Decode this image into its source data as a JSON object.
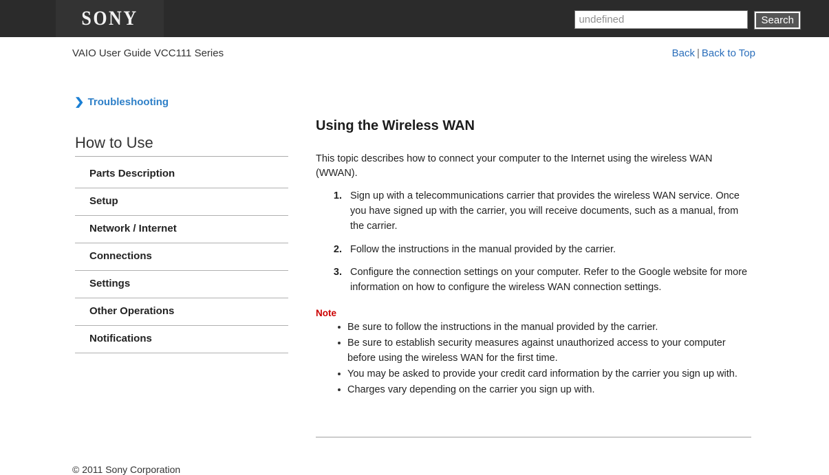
{
  "header": {
    "logo_text": "SONY",
    "search": {
      "value": "undefined",
      "placeholder": "undefined",
      "button_label": "Search"
    }
  },
  "subheader": {
    "guide_title": "VAIO User Guide VCC111 Series",
    "back_label": "Back",
    "separator": "|",
    "back_to_top_label": "Back to Top"
  },
  "sidebar": {
    "troubleshooting": {
      "chevron": "❯",
      "label": "Troubleshooting"
    },
    "section_heading": "How to Use",
    "items": [
      {
        "label": "Parts Description"
      },
      {
        "label": "Setup"
      },
      {
        "label": "Network / Internet"
      },
      {
        "label": "Connections"
      },
      {
        "label": "Settings"
      },
      {
        "label": "Other Operations"
      },
      {
        "label": "Notifications"
      }
    ]
  },
  "content": {
    "title": "Using the Wireless WAN",
    "intro": "This topic describes how to connect your computer to the Internet using the wireless WAN (WWAN).",
    "steps": [
      "Sign up with a telecommunications carrier that provides the wireless WAN service. Once you have signed up with the carrier, you will receive documents, such as a manual, from the carrier.",
      "Follow the instructions in the manual provided by the carrier.",
      "Configure the connection settings on your computer. Refer to the Google website for more information on how to configure the wireless WAN connection settings."
    ],
    "note_heading": "Note",
    "notes": [
      "Be sure to follow the instructions in the manual provided by the carrier.",
      "Be sure to establish security measures against unauthorized access to your computer before using the wireless WAN for the first time.",
      "You may be asked to provide your credit card information by the carrier you sign up with.",
      "Charges vary depending on the carrier you sign up with."
    ]
  },
  "footer": {
    "copyright": "© 2011 Sony Corporation"
  },
  "colors": {
    "header_bg": "#2b2b2b",
    "logo_box_bg": "#333333",
    "link_blue": "#2a6ebb",
    "troubleshooting_blue": "#2f80c8",
    "note_red": "#cc0000"
  }
}
